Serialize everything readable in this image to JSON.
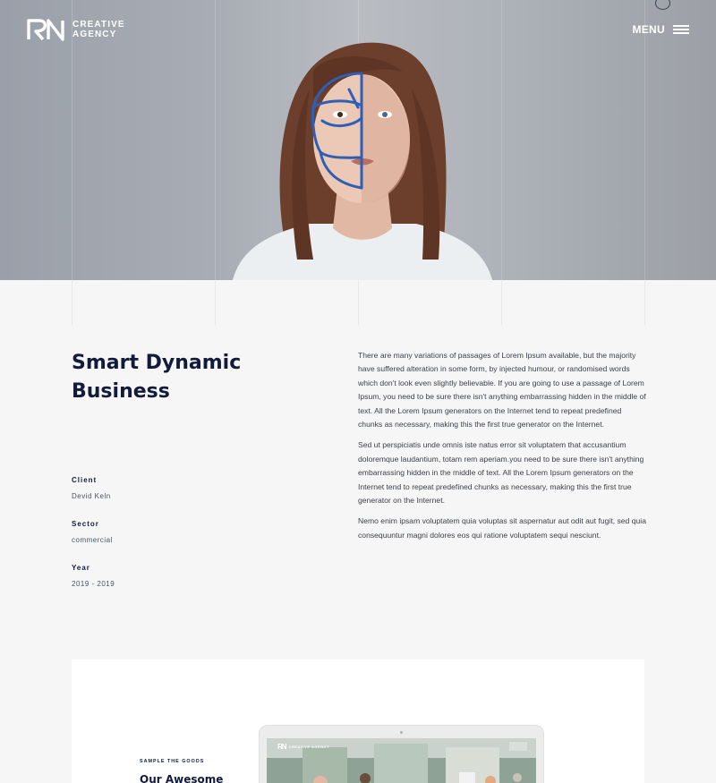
{
  "brand": {
    "mark": "RN",
    "line1": "CREATIVE",
    "line2": "AGENCY"
  },
  "nav": {
    "menu_label": "MENU"
  },
  "project": {
    "title": "Smart Dynamic Business",
    "client_label": "Client",
    "client_value": "Devid Keln",
    "sector_label": "Sector",
    "sector_value": "commercial",
    "year_label": "Year",
    "year_value": "2019 - 2019"
  },
  "description": [
    "There are many variations of passages of Lorem Ipsum available, but the majority have suffered alteration in some form, by injected humour, or randomised words which don't look even slightly believable. If you are going to use a passage of Lorem Ipsum, you need to be sure there isn't anything embarrassing hidden in the middle of text. All the Lorem Ipsum generators on the Internet tend to repeat predefined chunks as necessary, making this the first true generator on the Internet.",
    "Sed ut perspiciatis unde omnis iste natus error sit voluptatem that accusantium doloremque laudantium, totam rem aperiam.you need to be sure there isn't anything embarrassing hidden in the middle of text. All the Lorem Ipsum generators on the Internet tend to repeat predefined chunks as necessary, making this the first true generator on the Internet.",
    "Nemo enim ipsam voluptatem quia voluptas sit aspernatur aut odit aut fugit, sed quia consequuntur magni dolores eos qui ratione voluptatem sequi nesciunt."
  ],
  "sample": {
    "kicker": "SAMPLE THE GOODS",
    "heading": "Our Awesome",
    "screen_brand_mark": "RN",
    "screen_brand_text": "CREATIVE AGENCY"
  },
  "colors": {
    "heading": "#121c3a",
    "body_text": "#3b3f46",
    "page_bg": "#f6f6f6",
    "face_line": "#2f5fb5"
  },
  "icons": [
    "logo-icon",
    "hamburger-menu-icon",
    "cursor-ring-icon"
  ]
}
